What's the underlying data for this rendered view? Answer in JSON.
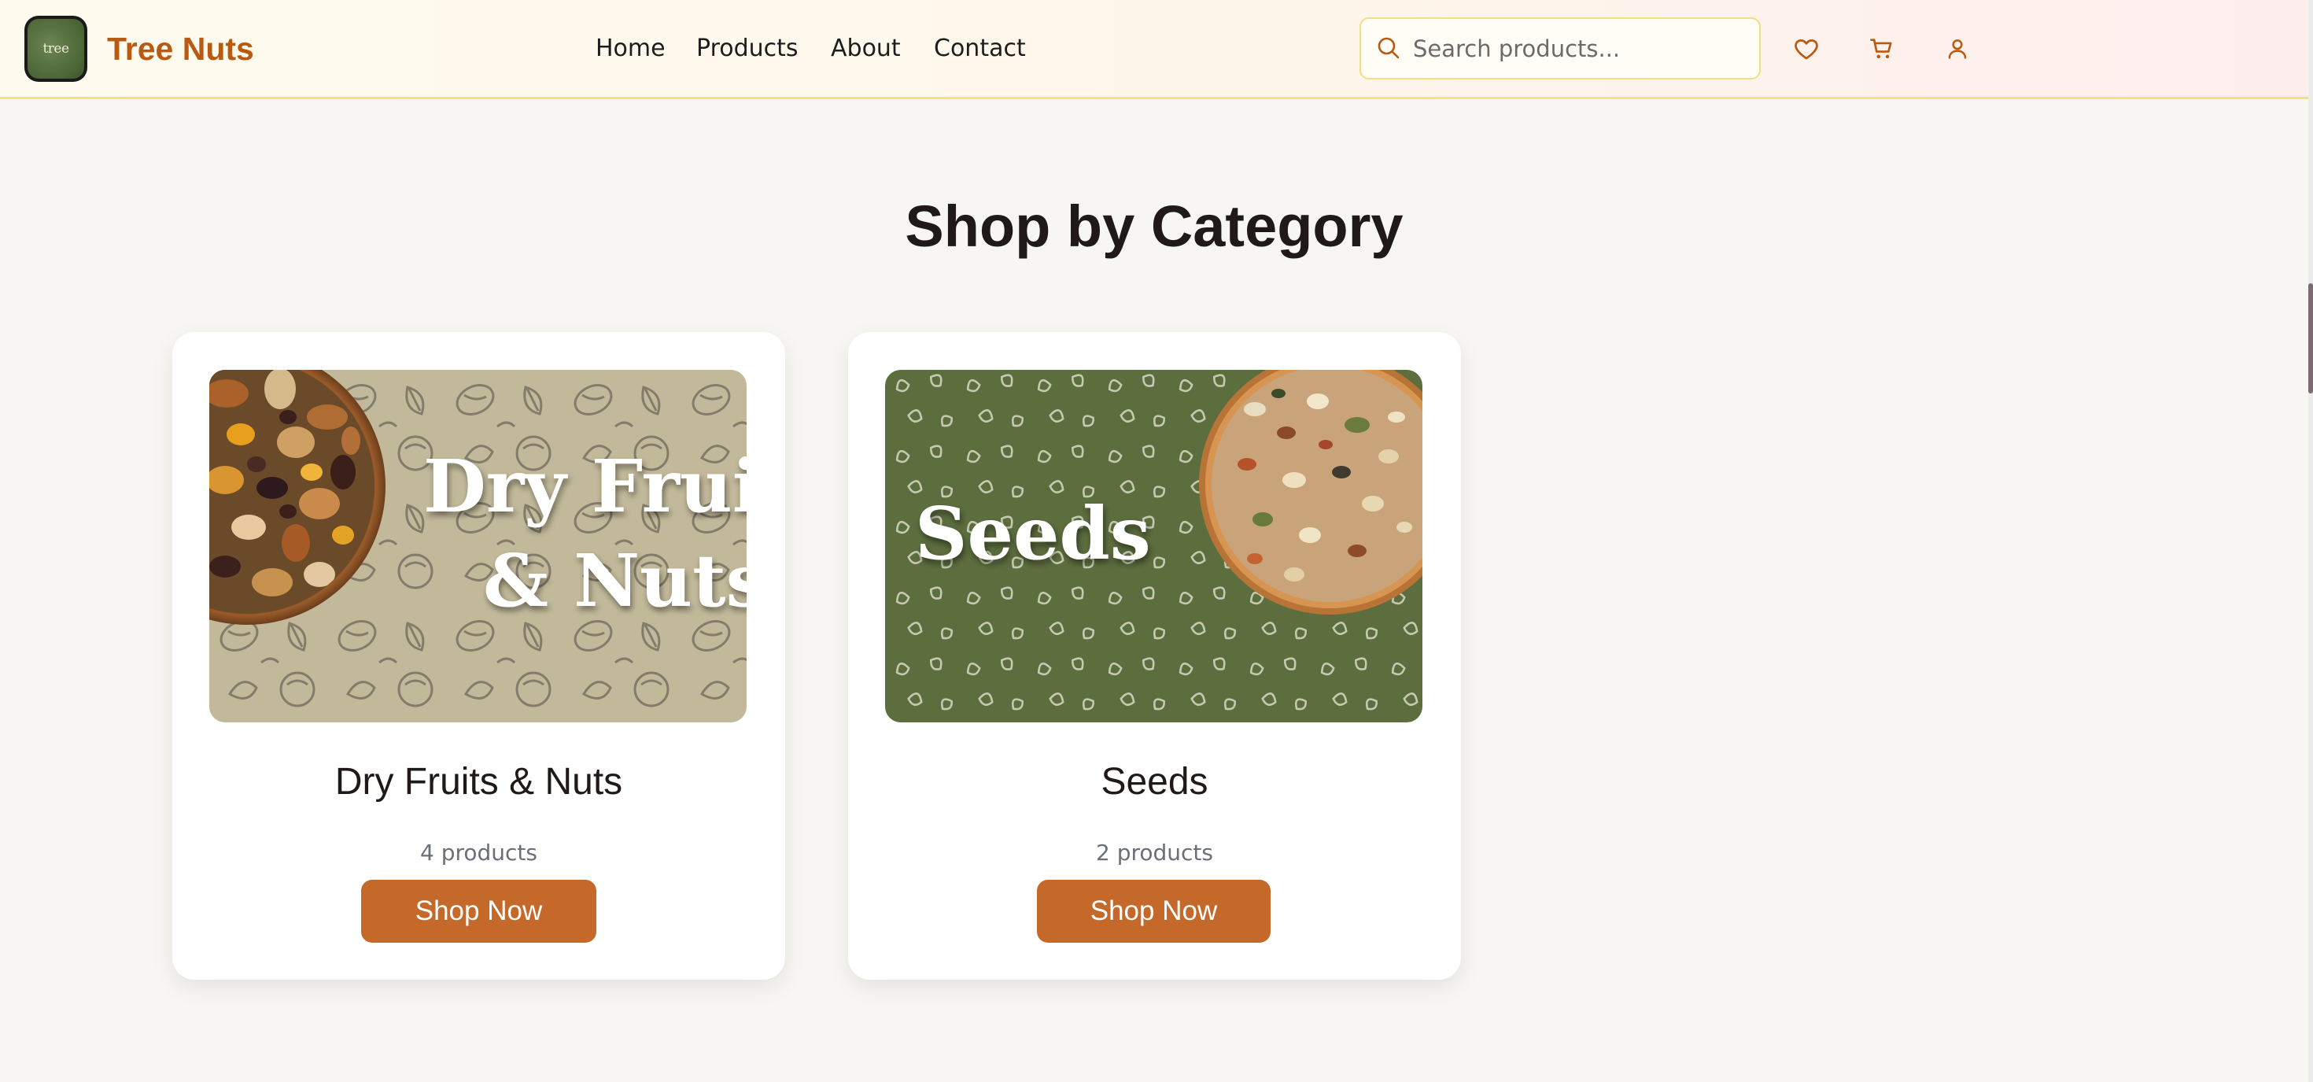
{
  "header": {
    "logo_text": "tree",
    "brand": "Tree Nuts",
    "nav": [
      "Home",
      "Products",
      "About",
      "Contact"
    ],
    "search": {
      "placeholder": "Search products...",
      "value": ""
    },
    "icons": [
      "heart-icon",
      "cart-icon",
      "user-icon"
    ]
  },
  "main": {
    "title": "Shop by Category",
    "categories": [
      {
        "name": "Dry Fruits & Nuts",
        "count": "4 products",
        "button": "Shop Now",
        "image": {
          "lines": [
            "Dry Fruits",
            "& Nuts"
          ],
          "bg": "#c2b99a",
          "pattern": "#6e685a"
        }
      },
      {
        "name": "Seeds",
        "count": "2 products",
        "button": "Shop Now",
        "image": {
          "lines": [
            "Seeds"
          ],
          "bg": "#5c6d3e",
          "pattern": "#cfd3bd"
        }
      }
    ]
  },
  "colors": {
    "brand": "#b95a12",
    "button": "#c4692a",
    "header_border": "#f4e08a",
    "page_bg": "#f7f6f2"
  }
}
